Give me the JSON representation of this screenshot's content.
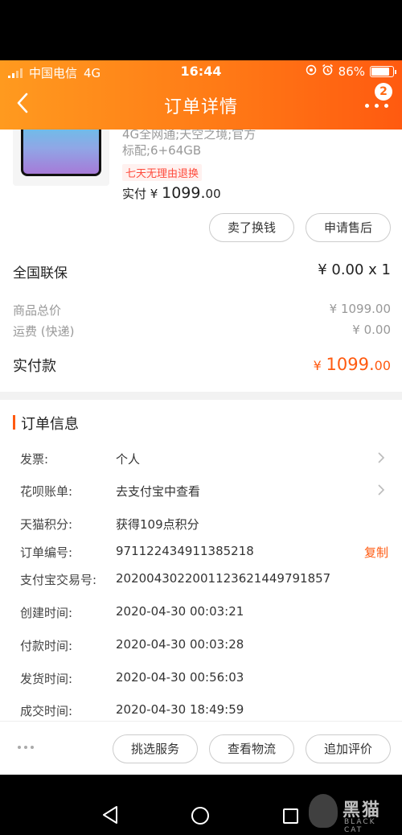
{
  "status_bar": {
    "carrier": "中国电信",
    "network": "4G",
    "time": "16:44",
    "battery": "86%",
    "battery_level": 0.86
  },
  "header": {
    "title": "订单详情",
    "badge_count": "2"
  },
  "product": {
    "desc_line1": "4G全网通;天空之境;官方",
    "desc_line2": "标配;6+64GB",
    "tag": "七天无理由退换",
    "paid_label": "实付",
    "price_symbol": "¥",
    "price_int": "1099.",
    "price_dec": "00"
  },
  "actions": {
    "sell": "卖了换钱",
    "after_sale": "申请售后"
  },
  "warranty": {
    "label": "全国联保",
    "value": "¥ 0.00 x 1"
  },
  "summary": {
    "goods_total_label": "商品总价",
    "goods_total_value": "¥ 1099.00",
    "shipping_label": "运费 (快递)",
    "shipping_value": "¥ 0.00",
    "paid_label": "实付款",
    "paid_symbol": "¥",
    "paid_int": "1099.",
    "paid_dec": "00"
  },
  "order_info": {
    "title": "订单信息",
    "invoice_label": "发票:",
    "invoice_value": "个人",
    "huabei_label": "花呗账单:",
    "huabei_value": "去支付宝中查看",
    "points_label": "天猫积分:",
    "points_value": "获得109点积分",
    "order_no_label": "订单编号:",
    "order_no_value": "971122434911385218",
    "copy_label": "复制",
    "alipay_no_label": "支付宝交易号:",
    "alipay_no_value": "2020043022001123621449791857",
    "created_label": "创建时间:",
    "created_value": "2020-04-30 00:03:21",
    "paid_time_label": "付款时间:",
    "paid_time_value": "2020-04-30 00:03:28",
    "shipped_label": "发货时间:",
    "shipped_value": "2020-04-30 00:56:03",
    "completed_label": "成交时间:",
    "completed_value": "2020-04-30 18:49:59"
  },
  "bottom_bar": {
    "select_service": "挑选服务",
    "view_logistics": "查看物流",
    "add_review": "追加评价"
  },
  "watermark": {
    "cn": "黑猫",
    "en": "BLACK CAT"
  },
  "colors": {
    "accent": "#ff5a10",
    "header_start": "#ff9a1f",
    "header_end": "#ff5a10"
  }
}
